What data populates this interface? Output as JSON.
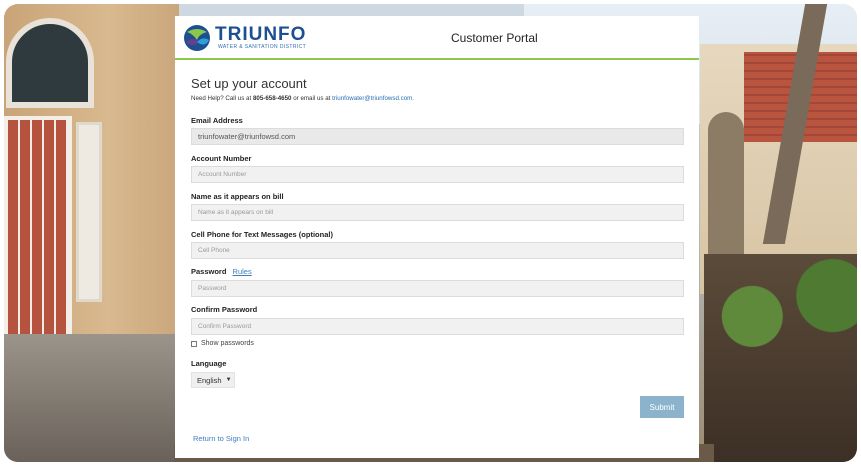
{
  "header": {
    "logo_name": "TRIUNFO",
    "logo_subtitle": "WATER & SANITATION DISTRICT",
    "portal_title": "Customer Portal"
  },
  "form": {
    "title": "Set up your account",
    "help_prefix": "Need Help? Call us at",
    "help_phone": "805-658-4650",
    "help_mid": "or email us at",
    "help_email": "triunfowater@triunfowsd.com.",
    "email": {
      "label": "Email Address",
      "value": "triunfowater@triunfowsd.com"
    },
    "account_number": {
      "label": "Account Number",
      "placeholder": "Account Number"
    },
    "name": {
      "label": "Name as it appears on bill",
      "placeholder": "Name as it appears on bill"
    },
    "cell": {
      "label": "Cell Phone for Text Messages (optional)",
      "placeholder": "Cell Phone"
    },
    "password": {
      "label": "Password",
      "rules_link": "Rules",
      "placeholder": "Password"
    },
    "confirm_password": {
      "label": "Confirm Password",
      "placeholder": "Confirm Password"
    },
    "show_passwords": "Show passwords",
    "language": {
      "label": "Language",
      "selected": "English",
      "caret": "▼"
    },
    "submit": "Submit",
    "return_link": "Return to Sign In"
  },
  "colors": {
    "brand_blue": "#1d4f91",
    "accent_green": "#8cc84b",
    "submit_bg": "#8bb4cc",
    "link": "#3d7fc1"
  },
  "icons": [
    "logo-mark-icon",
    "chevron-down-icon",
    "checkbox-icon"
  ]
}
